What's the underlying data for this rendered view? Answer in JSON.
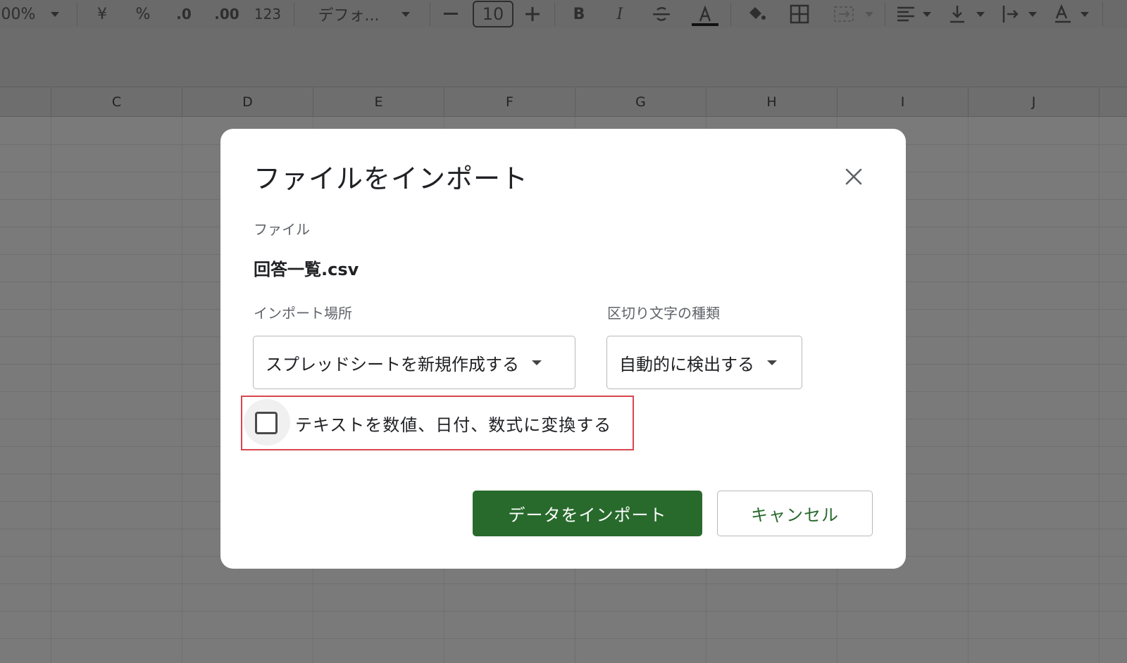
{
  "toolbar": {
    "zoom": "00%",
    "currency": "¥",
    "percent": "%",
    "decrease_decimal": ".0",
    "increase_decimal": ".00",
    "number_format": "123",
    "font_name": "デフォ...",
    "font_size": "10",
    "bold": "B",
    "italic": "I"
  },
  "columns": [
    "C",
    "D",
    "E",
    "F",
    "G",
    "H",
    "I",
    "J"
  ],
  "dialog": {
    "title": "ファイルをインポート",
    "file_label": "ファイル",
    "file_name": "回答一覧.csv",
    "import_location_label": "インポート場所",
    "import_location_value": "スプレッドシートを新規作成する",
    "separator_label": "区切り文字の種類",
    "separator_value": "自動的に検出する",
    "convert_checkbox_label": "テキストを数値、日付、数式に変換する",
    "convert_checked": false,
    "import_button": "データをインポート",
    "cancel_button": "キャンセル",
    "accent_color": "#286a2c",
    "highlight_color": "#d9454f"
  }
}
